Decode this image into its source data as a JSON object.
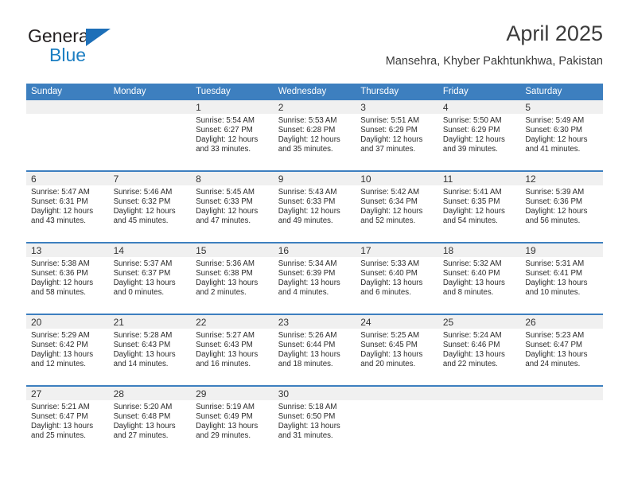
{
  "brand": {
    "name_top": "General",
    "name_bottom": "Blue",
    "triangle_color": "#1d6fb8",
    "blue_text_color": "#1b7ec2"
  },
  "header": {
    "title": "April 2025",
    "subtitle": "Mansehra, Khyber Pakhtunkhwa, Pakistan"
  },
  "theme": {
    "header_blue": "#3d7fbf",
    "daynum_band": "#f0f0f0",
    "text": "#2b2b2b"
  },
  "labels": {
    "sunrise_prefix": "Sunrise:",
    "sunset_prefix": "Sunset:",
    "daylight_prefix": "Daylight:"
  },
  "calendar": {
    "day_names": [
      "Sunday",
      "Monday",
      "Tuesday",
      "Wednesday",
      "Thursday",
      "Friday",
      "Saturday"
    ],
    "weeks": [
      [
        {
          "day": "",
          "empty": true
        },
        {
          "day": "",
          "empty": true
        },
        {
          "day": "1",
          "sunrise": "Sunrise: 5:54 AM",
          "sunset": "Sunset: 6:27 PM",
          "daylight_line1": "Daylight: 12 hours",
          "daylight_line2": "and 33 minutes."
        },
        {
          "day": "2",
          "sunrise": "Sunrise: 5:53 AM",
          "sunset": "Sunset: 6:28 PM",
          "daylight_line1": "Daylight: 12 hours",
          "daylight_line2": "and 35 minutes."
        },
        {
          "day": "3",
          "sunrise": "Sunrise: 5:51 AM",
          "sunset": "Sunset: 6:29 PM",
          "daylight_line1": "Daylight: 12 hours",
          "daylight_line2": "and 37 minutes."
        },
        {
          "day": "4",
          "sunrise": "Sunrise: 5:50 AM",
          "sunset": "Sunset: 6:29 PM",
          "daylight_line1": "Daylight: 12 hours",
          "daylight_line2": "and 39 minutes."
        },
        {
          "day": "5",
          "sunrise": "Sunrise: 5:49 AM",
          "sunset": "Sunset: 6:30 PM",
          "daylight_line1": "Daylight: 12 hours",
          "daylight_line2": "and 41 minutes."
        }
      ],
      [
        {
          "day": "6",
          "sunrise": "Sunrise: 5:47 AM",
          "sunset": "Sunset: 6:31 PM",
          "daylight_line1": "Daylight: 12 hours",
          "daylight_line2": "and 43 minutes."
        },
        {
          "day": "7",
          "sunrise": "Sunrise: 5:46 AM",
          "sunset": "Sunset: 6:32 PM",
          "daylight_line1": "Daylight: 12 hours",
          "daylight_line2": "and 45 minutes."
        },
        {
          "day": "8",
          "sunrise": "Sunrise: 5:45 AM",
          "sunset": "Sunset: 6:33 PM",
          "daylight_line1": "Daylight: 12 hours",
          "daylight_line2": "and 47 minutes."
        },
        {
          "day": "9",
          "sunrise": "Sunrise: 5:43 AM",
          "sunset": "Sunset: 6:33 PM",
          "daylight_line1": "Daylight: 12 hours",
          "daylight_line2": "and 49 minutes."
        },
        {
          "day": "10",
          "sunrise": "Sunrise: 5:42 AM",
          "sunset": "Sunset: 6:34 PM",
          "daylight_line1": "Daylight: 12 hours",
          "daylight_line2": "and 52 minutes."
        },
        {
          "day": "11",
          "sunrise": "Sunrise: 5:41 AM",
          "sunset": "Sunset: 6:35 PM",
          "daylight_line1": "Daylight: 12 hours",
          "daylight_line2": "and 54 minutes."
        },
        {
          "day": "12",
          "sunrise": "Sunrise: 5:39 AM",
          "sunset": "Sunset: 6:36 PM",
          "daylight_line1": "Daylight: 12 hours",
          "daylight_line2": "and 56 minutes."
        }
      ],
      [
        {
          "day": "13",
          "sunrise": "Sunrise: 5:38 AM",
          "sunset": "Sunset: 6:36 PM",
          "daylight_line1": "Daylight: 12 hours",
          "daylight_line2": "and 58 minutes."
        },
        {
          "day": "14",
          "sunrise": "Sunrise: 5:37 AM",
          "sunset": "Sunset: 6:37 PM",
          "daylight_line1": "Daylight: 13 hours",
          "daylight_line2": "and 0 minutes."
        },
        {
          "day": "15",
          "sunrise": "Sunrise: 5:36 AM",
          "sunset": "Sunset: 6:38 PM",
          "daylight_line1": "Daylight: 13 hours",
          "daylight_line2": "and 2 minutes."
        },
        {
          "day": "16",
          "sunrise": "Sunrise: 5:34 AM",
          "sunset": "Sunset: 6:39 PM",
          "daylight_line1": "Daylight: 13 hours",
          "daylight_line2": "and 4 minutes."
        },
        {
          "day": "17",
          "sunrise": "Sunrise: 5:33 AM",
          "sunset": "Sunset: 6:40 PM",
          "daylight_line1": "Daylight: 13 hours",
          "daylight_line2": "and 6 minutes."
        },
        {
          "day": "18",
          "sunrise": "Sunrise: 5:32 AM",
          "sunset": "Sunset: 6:40 PM",
          "daylight_line1": "Daylight: 13 hours",
          "daylight_line2": "and 8 minutes."
        },
        {
          "day": "19",
          "sunrise": "Sunrise: 5:31 AM",
          "sunset": "Sunset: 6:41 PM",
          "daylight_line1": "Daylight: 13 hours",
          "daylight_line2": "and 10 minutes."
        }
      ],
      [
        {
          "day": "20",
          "sunrise": "Sunrise: 5:29 AM",
          "sunset": "Sunset: 6:42 PM",
          "daylight_line1": "Daylight: 13 hours",
          "daylight_line2": "and 12 minutes."
        },
        {
          "day": "21",
          "sunrise": "Sunrise: 5:28 AM",
          "sunset": "Sunset: 6:43 PM",
          "daylight_line1": "Daylight: 13 hours",
          "daylight_line2": "and 14 minutes."
        },
        {
          "day": "22",
          "sunrise": "Sunrise: 5:27 AM",
          "sunset": "Sunset: 6:43 PM",
          "daylight_line1": "Daylight: 13 hours",
          "daylight_line2": "and 16 minutes."
        },
        {
          "day": "23",
          "sunrise": "Sunrise: 5:26 AM",
          "sunset": "Sunset: 6:44 PM",
          "daylight_line1": "Daylight: 13 hours",
          "daylight_line2": "and 18 minutes."
        },
        {
          "day": "24",
          "sunrise": "Sunrise: 5:25 AM",
          "sunset": "Sunset: 6:45 PM",
          "daylight_line1": "Daylight: 13 hours",
          "daylight_line2": "and 20 minutes."
        },
        {
          "day": "25",
          "sunrise": "Sunrise: 5:24 AM",
          "sunset": "Sunset: 6:46 PM",
          "daylight_line1": "Daylight: 13 hours",
          "daylight_line2": "and 22 minutes."
        },
        {
          "day": "26",
          "sunrise": "Sunrise: 5:23 AM",
          "sunset": "Sunset: 6:47 PM",
          "daylight_line1": "Daylight: 13 hours",
          "daylight_line2": "and 24 minutes."
        }
      ],
      [
        {
          "day": "27",
          "sunrise": "Sunrise: 5:21 AM",
          "sunset": "Sunset: 6:47 PM",
          "daylight_line1": "Daylight: 13 hours",
          "daylight_line2": "and 25 minutes."
        },
        {
          "day": "28",
          "sunrise": "Sunrise: 5:20 AM",
          "sunset": "Sunset: 6:48 PM",
          "daylight_line1": "Daylight: 13 hours",
          "daylight_line2": "and 27 minutes."
        },
        {
          "day": "29",
          "sunrise": "Sunrise: 5:19 AM",
          "sunset": "Sunset: 6:49 PM",
          "daylight_line1": "Daylight: 13 hours",
          "daylight_line2": "and 29 minutes."
        },
        {
          "day": "30",
          "sunrise": "Sunrise: 5:18 AM",
          "sunset": "Sunset: 6:50 PM",
          "daylight_line1": "Daylight: 13 hours",
          "daylight_line2": "and 31 minutes."
        },
        {
          "day": "",
          "empty": true
        },
        {
          "day": "",
          "empty": true
        },
        {
          "day": "",
          "empty": true
        }
      ]
    ]
  }
}
